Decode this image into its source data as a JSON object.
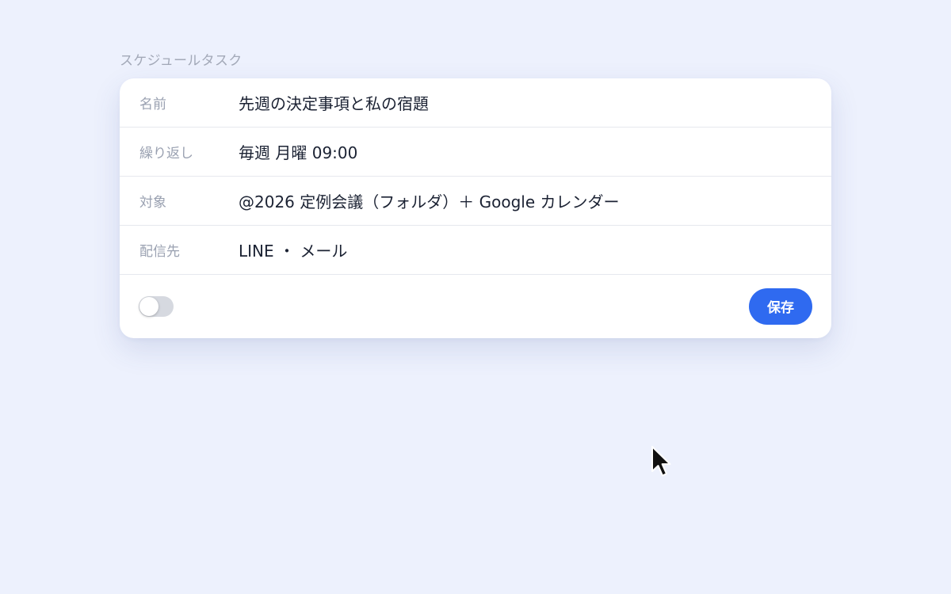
{
  "section": {
    "title": "スケジュールタスク"
  },
  "fields": [
    {
      "label": "名前",
      "value": "先週の決定事項と私の宿題"
    },
    {
      "label": "繰り返し",
      "value": "毎週 月曜 09:00"
    },
    {
      "label": "対象",
      "value": "@2026 定例会議（フォルダ）＋ Google カレンダー"
    },
    {
      "label": "配信先",
      "value": "LINE ・ メール"
    }
  ],
  "footer": {
    "toggle_enabled": false,
    "save_label": "保存"
  },
  "colors": {
    "accent": "#2f6af0",
    "background": "#edf1fd",
    "toggle_off": "#d6d9e0"
  },
  "icons": {
    "cursor": "mouse-pointer-icon"
  }
}
